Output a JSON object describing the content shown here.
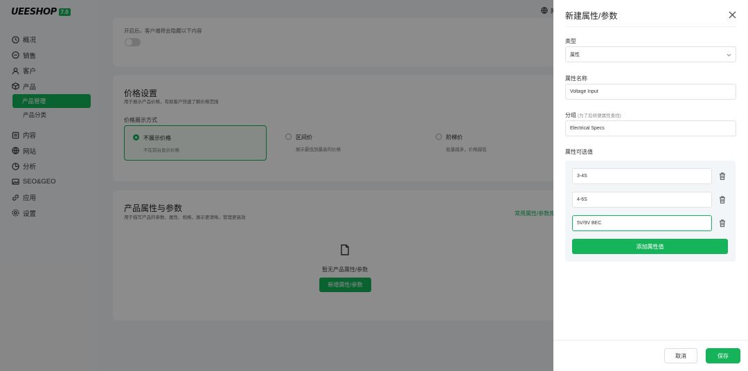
{
  "app": {
    "logo_text": "UEESHOP",
    "version": "7.0"
  },
  "sidebar": {
    "items": [
      {
        "label": "概况",
        "icon": "clock-icon"
      },
      {
        "label": "销售",
        "icon": "chat-icon"
      },
      {
        "label": "客户",
        "icon": "user-icon"
      },
      {
        "label": "产品",
        "icon": "box-icon"
      },
      {
        "label": "内容",
        "icon": "document-icon"
      },
      {
        "label": "网站",
        "icon": "globe-icon"
      },
      {
        "label": "分析",
        "icon": "chart-icon"
      },
      {
        "label": "SEO&GEO",
        "icon": "image-icon"
      },
      {
        "label": "应用",
        "icon": "link-icon"
      },
      {
        "label": "设置",
        "icon": "gear-icon"
      }
    ],
    "sub_items": [
      {
        "label": "产品管理",
        "active": true
      },
      {
        "label": "产品分类",
        "active": false
      }
    ]
  },
  "topbar": {
    "globe_label": "网"
  },
  "card_toggle": {
    "hint": "开启后，客户端将会隐藏以下内容"
  },
  "price_settings": {
    "title": "价格设置",
    "subtitle": "用于展示产品价格，有助客户快速了解价格范围",
    "display_label": "价格展示方式",
    "options": [
      {
        "title": "不展示价格",
        "desc": "不在前台显示价格",
        "selected": true
      },
      {
        "title": "区间价",
        "desc": "展示最低到最高的价格",
        "selected": false
      },
      {
        "title": "阶梯价",
        "desc": "批量越多，价格越低",
        "selected": false
      }
    ]
  },
  "attributes": {
    "title": "产品属性与参数",
    "subtitle": "用于描写产品的参数、属性、规格，展示更清晰，管理更高效",
    "link": "常用属性/参数库",
    "empty_text": "暂无产品属性/参数",
    "add_button": "新增属性/参数"
  },
  "drawer": {
    "title": "新建属性/参数",
    "type_label": "类型",
    "type_value": "属性",
    "name_label": "属性名称",
    "name_value": "Voltage Input",
    "group_label": "分组",
    "group_note": "(为了后续便属性查找)",
    "group_value": "Electrical Specs",
    "values_label": "属性可选值",
    "values": [
      "3-4S",
      "4-6S",
      "5V/9V BEC"
    ],
    "add_value_button": "添加属性值",
    "cancel": "取消",
    "save": "保存"
  },
  "colors": {
    "accent": "#15b35a"
  }
}
